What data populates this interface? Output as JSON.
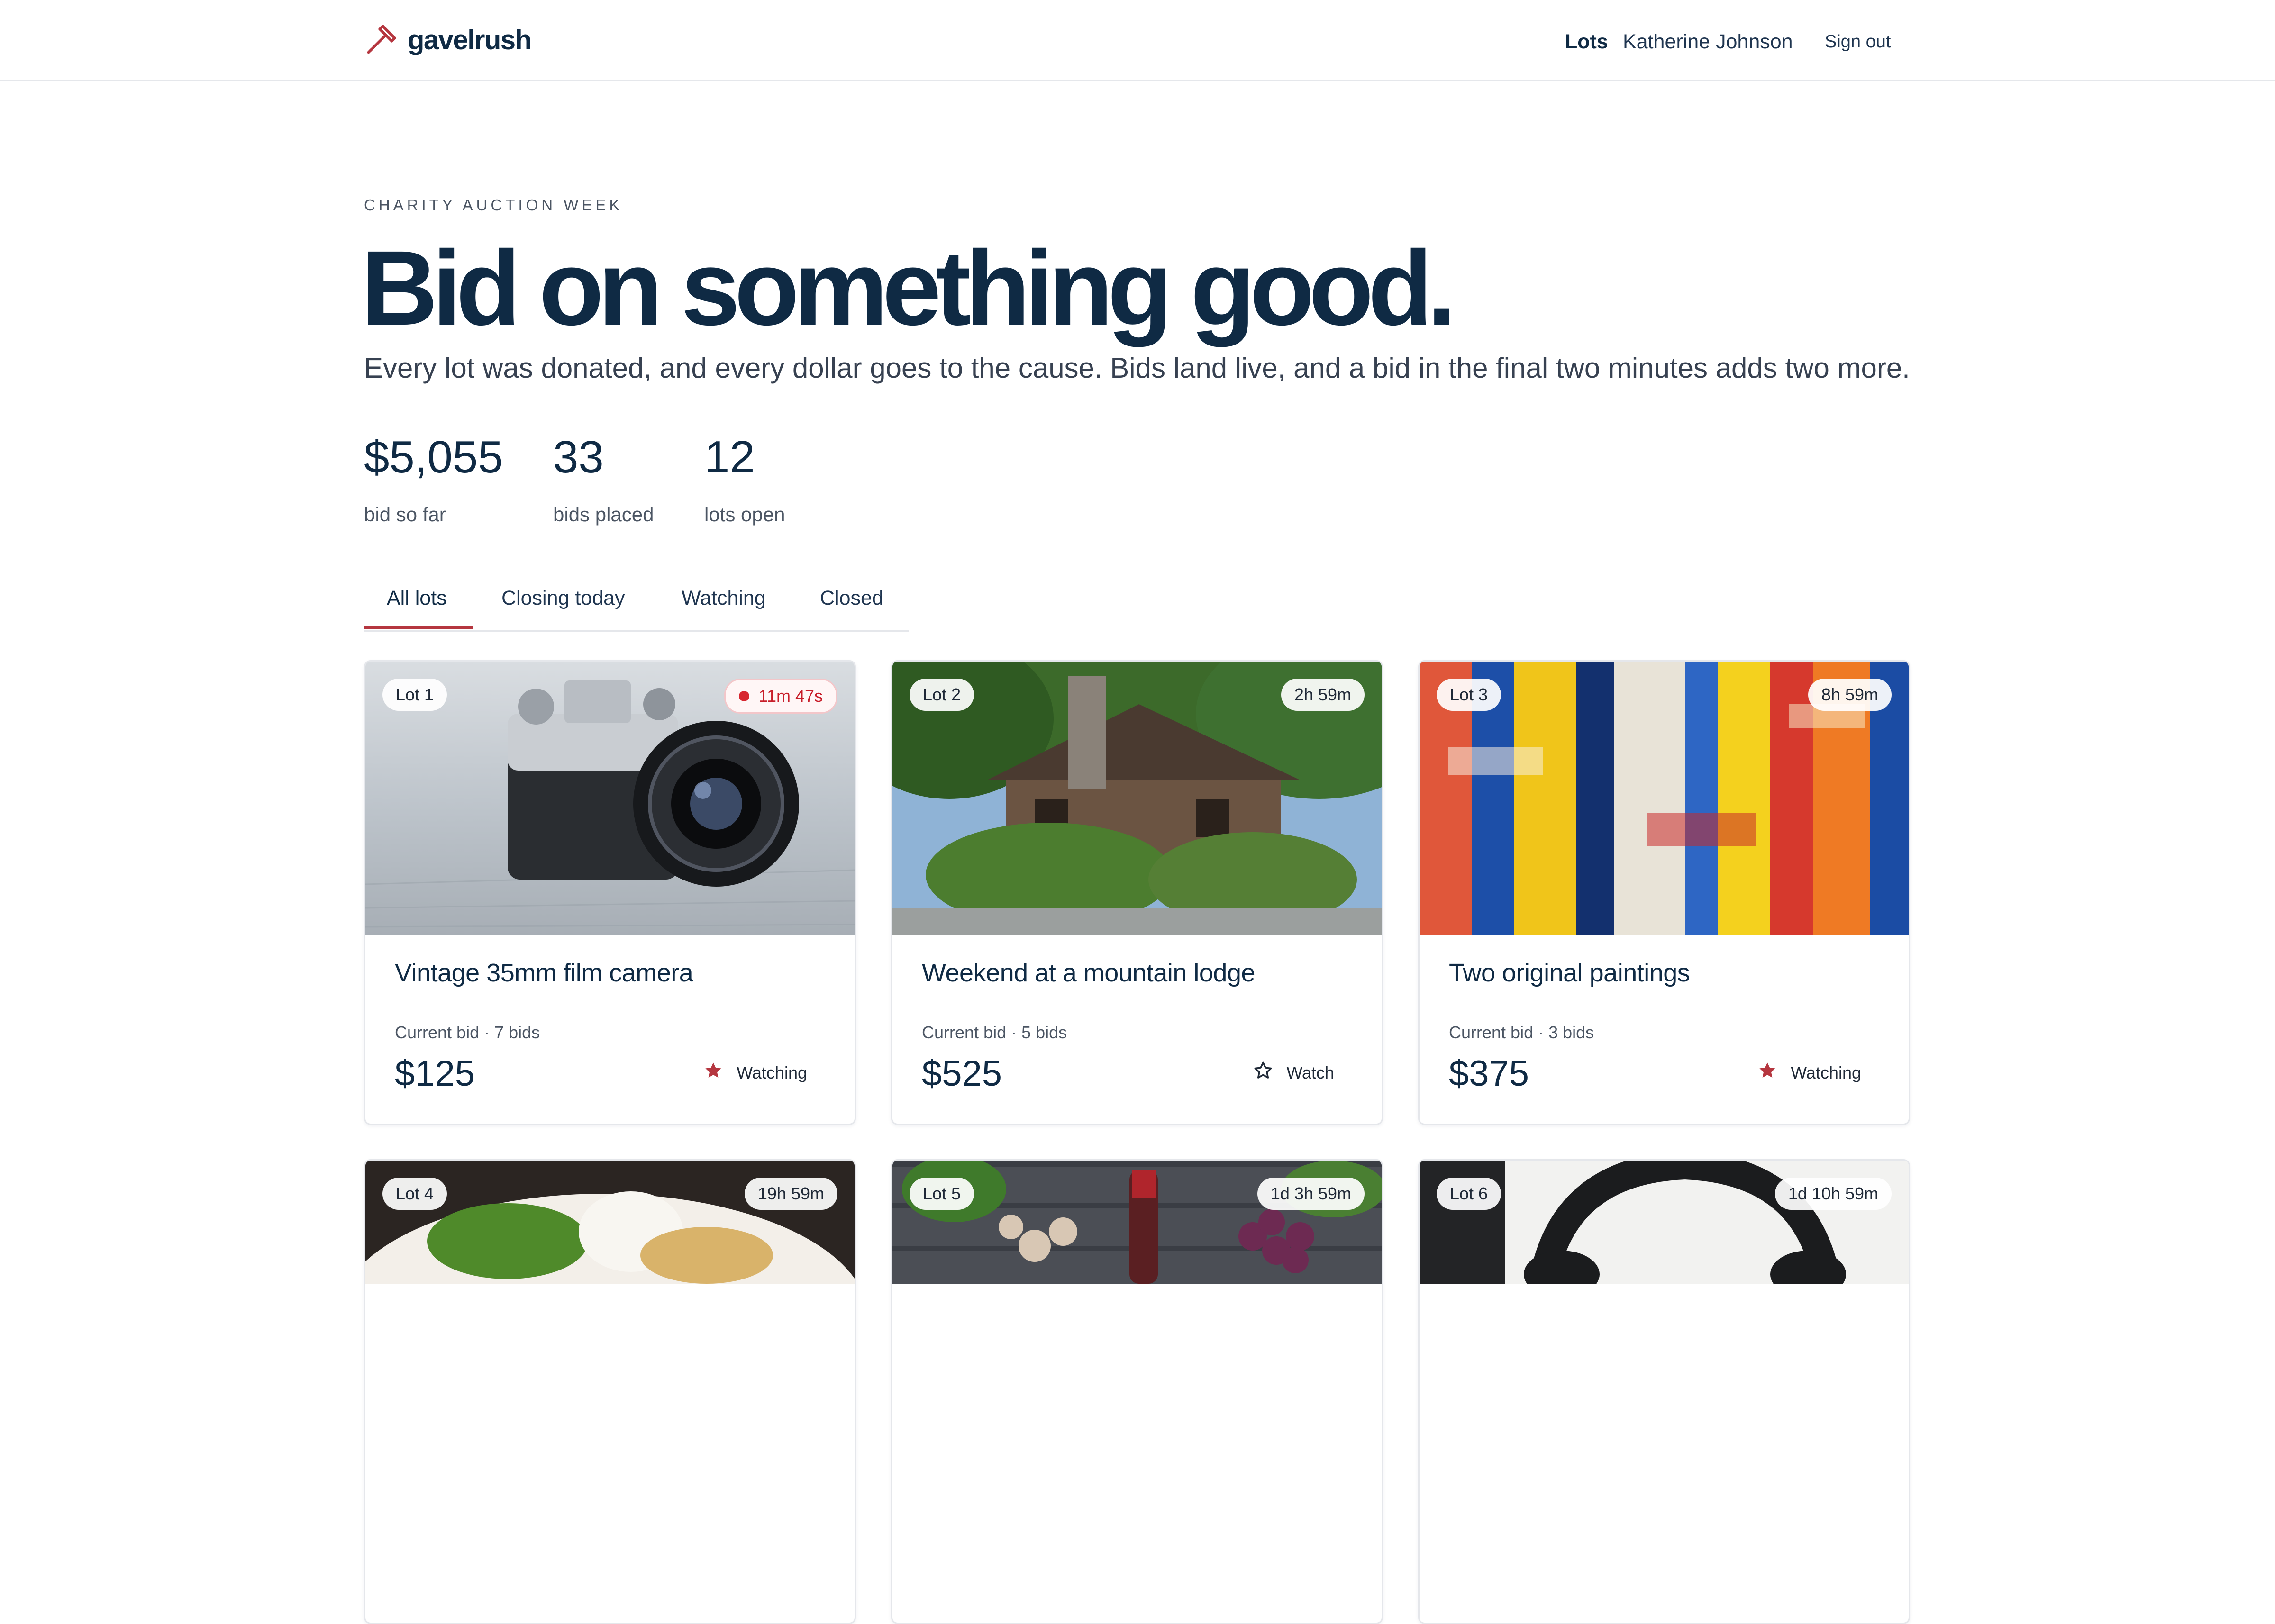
{
  "header": {
    "brand": "gavelrush",
    "nav_lots": "Lots",
    "user_name": "Katherine Johnson",
    "sign_out": "Sign out"
  },
  "hero": {
    "eyebrow": "CHARITY AUCTION WEEK",
    "title": "Bid on something good.",
    "subtitle": "Every lot was donated, and every dollar goes to the cause. Bids land live, and a bid in the final two minutes adds two more."
  },
  "stats": [
    {
      "value": "$5,055",
      "label": "bid so far"
    },
    {
      "value": "33",
      "label": "bids placed"
    },
    {
      "value": "12",
      "label": "lots open"
    }
  ],
  "tabs": [
    {
      "label": "All lots",
      "active": true
    },
    {
      "label": "Closing today",
      "active": false
    },
    {
      "label": "Watching",
      "active": false
    },
    {
      "label": "Closed",
      "active": false
    }
  ],
  "lots": [
    {
      "lot": "Lot 1",
      "time": "11m 47s",
      "urgent": true,
      "title": "Vintage 35mm film camera",
      "meta": "Current bid · 7 bids",
      "price": "$125",
      "watch_label": "Watching",
      "watching": true,
      "image": "film-camera-photo"
    },
    {
      "lot": "Lot 2",
      "time": "2h 59m",
      "urgent": false,
      "title": "Weekend at a mountain lodge",
      "meta": "Current bid · 5 bids",
      "price": "$525",
      "watch_label": "Watch",
      "watching": false,
      "image": "mountain-lodge-photo"
    },
    {
      "lot": "Lot 3",
      "time": "8h 59m",
      "urgent": false,
      "title": "Two original paintings",
      "meta": "Current bid · 3 bids",
      "price": "$375",
      "watch_label": "Watching",
      "watching": true,
      "image": "abstract-painting-photo"
    },
    {
      "lot": "Lot 4",
      "time": "19h 59m",
      "urgent": false,
      "image": "plated-dish-photo"
    },
    {
      "lot": "Lot 5",
      "time": "1d 3h 59m",
      "urgent": false,
      "image": "wine-and-grapes-photo"
    },
    {
      "lot": "Lot 6",
      "time": "1d 10h 59m",
      "urgent": false,
      "image": "headphones-photo"
    }
  ],
  "colors": {
    "accent": "#b5363f",
    "ink": "#0f2a44",
    "muted": "#4b5563",
    "urgent": "#d7262f"
  }
}
